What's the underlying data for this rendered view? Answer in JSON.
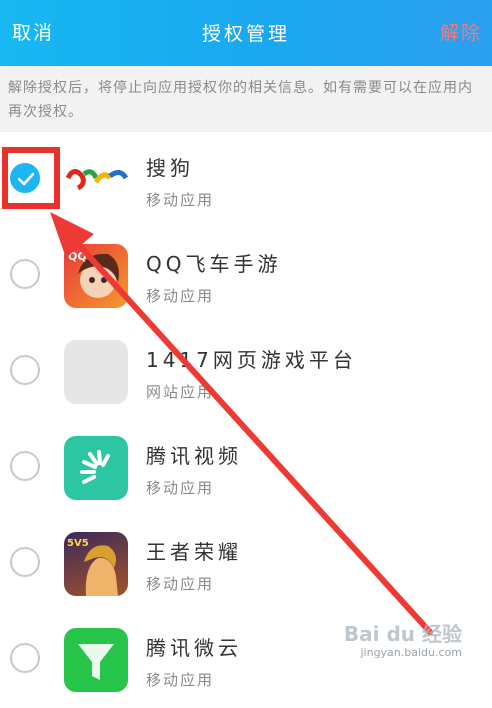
{
  "header": {
    "cancel": "取消",
    "title": "授权管理",
    "unbind": "解除"
  },
  "notice": "解除授权后，将停止向应用授权你的相关信息。如有需要可以在应用内再次授权。",
  "apps": [
    {
      "name": "搜狗",
      "type": "移动应用",
      "checked": true,
      "icon": "sogou-icon"
    },
    {
      "name": "QQ飞车手游",
      "type": "移动应用",
      "checked": false,
      "icon": "qq-speed-icon"
    },
    {
      "name": "1417网页游戏平台",
      "type": "网站应用",
      "checked": false,
      "icon": "placeholder-icon"
    },
    {
      "name": "腾讯视频",
      "type": "移动应用",
      "checked": false,
      "icon": "green-app-icon"
    },
    {
      "name": "王者荣耀",
      "type": "移动应用",
      "checked": false,
      "icon": "honor-of-kings-icon"
    },
    {
      "name": "腾讯微云",
      "type": "移动应用",
      "checked": false,
      "icon": "weiyun-icon"
    }
  ],
  "watermark": {
    "logo": "Bai du 经验",
    "url": "jingyan.baidu.com"
  }
}
